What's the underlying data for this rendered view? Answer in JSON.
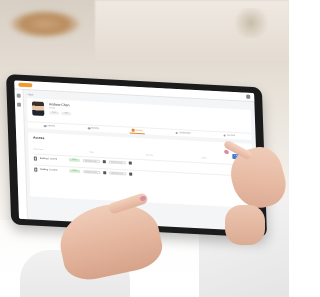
{
  "scene": {
    "description_tags": [
      "photo-background",
      "tablet",
      "hands"
    ]
  },
  "app": {
    "brand_color": "#f29a2e",
    "back_label": "Back",
    "profile": {
      "name": "Andrew Chen",
      "subtitle": "Tenant",
      "tags": [
        "Guest",
        "Staff"
      ]
    },
    "tabs": [
      {
        "label": "Identity",
        "icon": "id-icon"
      },
      {
        "label": "Mobility",
        "icon": "car-icon"
      },
      {
        "label": "Access",
        "icon": "key-icon"
      },
      {
        "label": "Credentials",
        "icon": "card-icon"
      },
      {
        "label": "Account",
        "icon": "user-icon"
      }
    ],
    "active_tab_index": 2,
    "access": {
      "title": "Access",
      "add_button": "+ Access Level",
      "columns": [
        "Access Level",
        "Status",
        "Valid From",
        "Valid To"
      ],
      "rows": [
        {
          "label": "Building 1 Level 4",
          "status": "Active",
          "from": "08/01/2022 09:00",
          "to": "08/01/2023 17:00"
        },
        {
          "label": "Building 1 Level 5",
          "status": "Active",
          "from": "08/01/2022 09:00",
          "to": "08/01/2023 17:00"
        }
      ],
      "status_color": "#3a9a3a",
      "button_color": "#3d7bd6"
    }
  }
}
